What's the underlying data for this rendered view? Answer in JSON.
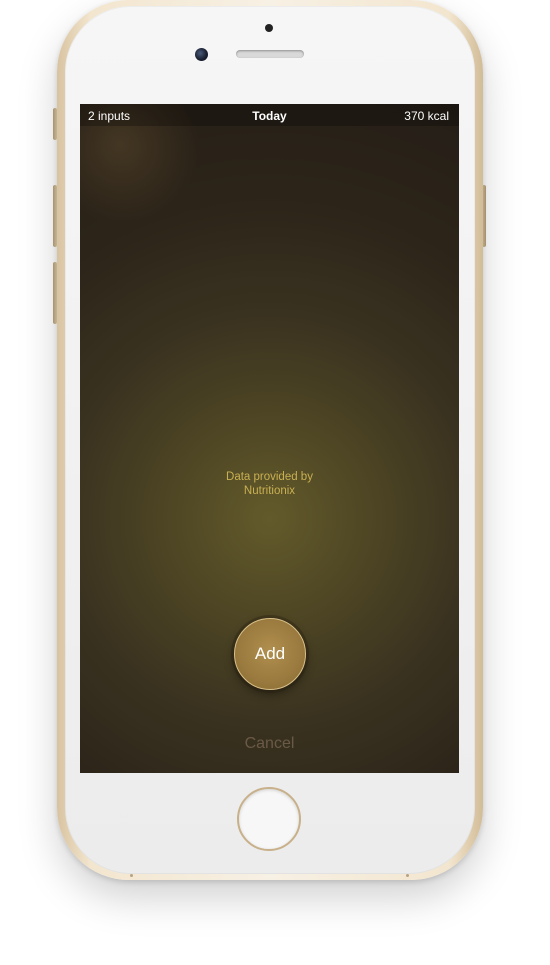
{
  "status_bar": {
    "inputs": "2 inputs",
    "title": "Today",
    "calories": "370 kcal"
  },
  "main": {
    "credit_line1": "Data provided by",
    "credit_line2": "Nutritionix",
    "add_label": "Add",
    "cancel_label": "Cancel"
  },
  "colors": {
    "accent_gold": "#9a7a3e",
    "credit_text": "#c9b052",
    "cancel_text": "#6a5a45",
    "device_rim": "#e8d6b6"
  },
  "icons": {
    "home_button": "home-button-icon",
    "front_camera": "front-camera-icon",
    "earpiece": "earpiece-speaker-icon"
  }
}
